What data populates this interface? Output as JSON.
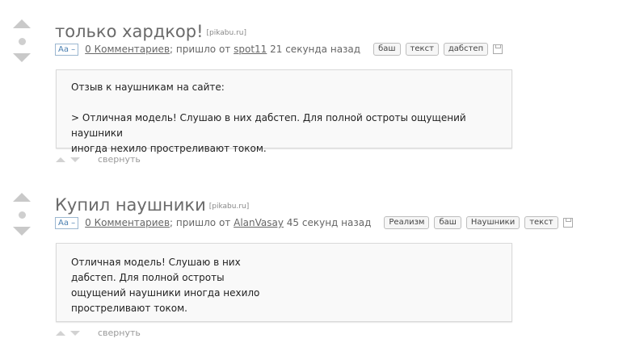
{
  "posts": [
    {
      "title": "только хардкор!",
      "source": "[pikabu.ru]",
      "font_toggle": "Aa –",
      "comments": "0 Комментариев",
      "came_from": "; пришло от",
      "author": "spot11",
      "time": "21 секунда назад",
      "tags": [
        "баш",
        "текст",
        "дабстеп"
      ],
      "body_line1": "Отзыв к наушникам на сайте:",
      "body_line2": "> Отличная модель! Слушаю в них дабстеп. Для полной остроты ощущений наушники",
      "body_line3": "иногда нехило простреливают током.",
      "collapse": "свернуть"
    },
    {
      "title": "Купил наушники",
      "source": "[pikabu.ru]",
      "font_toggle": "Aa –",
      "comments": "0 Комментариев",
      "came_from": "; пришло от",
      "author": "AlanVasay",
      "time": "45 секунд назад",
      "tags": [
        "Реализм",
        "баш",
        "Наушники",
        "текст"
      ],
      "body_line1": "Отличная модель! Слушаю в них",
      "body_line2": "дабстеп. Для полной остроты",
      "body_line3": "ощущений наушники иногда нехило",
      "body_line4": "простреливают током.",
      "collapse": "свернуть"
    }
  ]
}
